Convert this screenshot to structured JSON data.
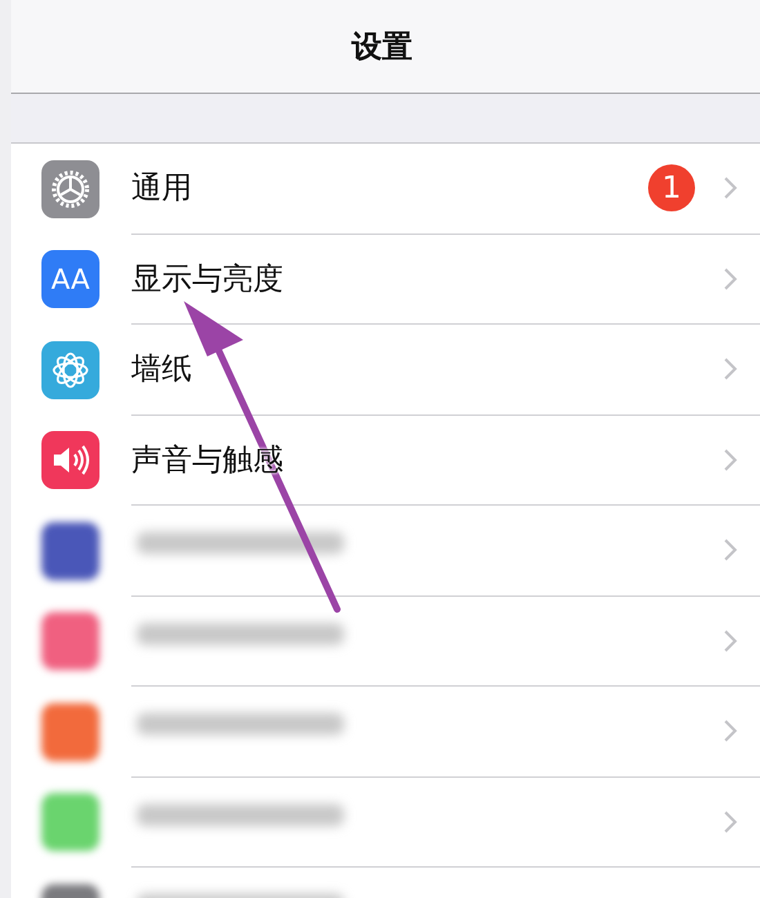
{
  "title": "设置",
  "rows": [
    {
      "kind": "item",
      "color": "#8e8e93",
      "label": "通用",
      "badge": "1"
    },
    {
      "kind": "item",
      "color": "#2f7cf6",
      "label": "显示与亮度",
      "icon_text": "AA"
    },
    {
      "kind": "item",
      "color": "#35aadc",
      "label": "墙纸"
    },
    {
      "kind": "item",
      "color": "#f0375b",
      "label": "声音与触感"
    },
    {
      "kind": "blurred",
      "color": "#4a57b8"
    },
    {
      "kind": "blurred",
      "color": "#f06080"
    },
    {
      "kind": "blurred",
      "color": "#f26a3c"
    },
    {
      "kind": "blurred",
      "color": "#6ad46e"
    },
    {
      "kind": "blurred",
      "color": "#7a7a7e"
    }
  ]
}
